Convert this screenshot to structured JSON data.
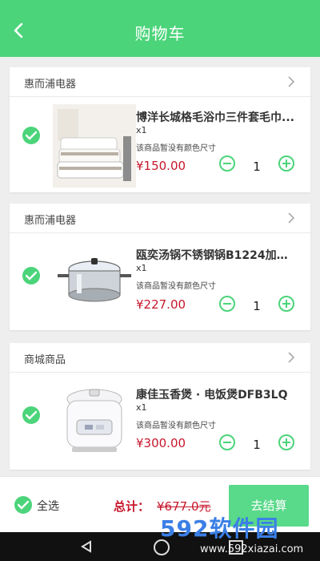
{
  "header": {
    "title": "购物车"
  },
  "items": [
    {
      "shop": "惠而浦电器",
      "name": "博洋长城格毛浴巾三件套毛巾...",
      "qty_line": "x1",
      "attr": "该商品暂没有颜色尺寸",
      "price": "¥150.00",
      "qty": "1",
      "image": "towel-set"
    },
    {
      "shop": "惠而浦电器",
      "name": "瓯奕汤锅不锈钢锅B1224加厚...",
      "qty_line": "x1",
      "attr": "该商品暂没有颜色尺寸",
      "price": "¥227.00",
      "qty": "1",
      "image": "stainless-pot"
    },
    {
      "shop": "商城商品",
      "name": "康佳玉香煲 · 电饭煲DFB3LQ",
      "qty_line": "x1",
      "attr": "该商品暂没有颜色尺寸",
      "price": "¥300.00",
      "qty": "1",
      "image": "rice-cooker"
    }
  ],
  "footer": {
    "select_all": "全选",
    "total_label": "总计：",
    "total_value": "¥677.0元",
    "checkout": "去结算"
  },
  "watermark": {
    "text": "592软件园",
    "url": "www.592xiazai.com"
  },
  "colors": {
    "accent": "#4cd47a",
    "price": "#c6172b"
  }
}
